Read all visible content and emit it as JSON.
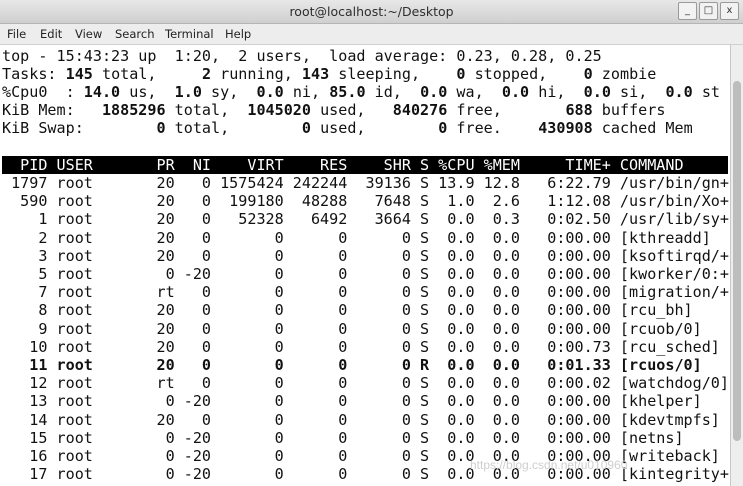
{
  "window": {
    "title": "root@localhost:~/Desktop",
    "buttons": [
      "_",
      "□",
      "x"
    ]
  },
  "menu": [
    "File",
    "Edit",
    "View",
    "Search",
    "Terminal",
    "Help"
  ],
  "summary": {
    "top_line": "top - 15:43:23 up  1:20,  2 users,  load average: 0.23, 0.28, 0.25",
    "tasks": [
      {
        "t": "Tasks: ",
        "b": false
      },
      {
        "t": "145",
        "b": true
      },
      {
        "t": " total,   ",
        "b": false
      },
      {
        "t": "  2",
        "b": true
      },
      {
        "t": " running, ",
        "b": false
      },
      {
        "t": "143",
        "b": true
      },
      {
        "t": " sleeping,  ",
        "b": false
      },
      {
        "t": "  0",
        "b": true
      },
      {
        "t": " stopped,  ",
        "b": false
      },
      {
        "t": "  0",
        "b": true
      },
      {
        "t": " zombie",
        "b": false
      }
    ],
    "cpu": [
      {
        "t": "%Cpu0  : ",
        "b": false
      },
      {
        "t": "14.0",
        "b": true
      },
      {
        "t": " us, ",
        "b": false
      },
      {
        "t": " 1.0",
        "b": true
      },
      {
        "t": " sy, ",
        "b": false
      },
      {
        "t": " 0.0",
        "b": true
      },
      {
        "t": " ni, ",
        "b": false
      },
      {
        "t": "85.0",
        "b": true
      },
      {
        "t": " id, ",
        "b": false
      },
      {
        "t": " 0.0",
        "b": true
      },
      {
        "t": " wa, ",
        "b": false
      },
      {
        "t": " 0.0",
        "b": true
      },
      {
        "t": " hi, ",
        "b": false
      },
      {
        "t": " 0.0",
        "b": true
      },
      {
        "t": " si, ",
        "b": false
      },
      {
        "t": " 0.0",
        "b": true
      },
      {
        "t": " st",
        "b": false
      }
    ],
    "mem": [
      {
        "t": "KiB Mem:  ",
        "b": false
      },
      {
        "t": " 1885296",
        "b": true
      },
      {
        "t": " total, ",
        "b": false
      },
      {
        "t": " 1045020",
        "b": true
      },
      {
        "t": " used, ",
        "b": false
      },
      {
        "t": "  840276",
        "b": true
      },
      {
        "t": " free,  ",
        "b": false
      },
      {
        "t": "     688",
        "b": true
      },
      {
        "t": " buffers",
        "b": false
      }
    ],
    "swap": [
      {
        "t": "KiB Swap: ",
        "b": false
      },
      {
        "t": "       0",
        "b": true
      },
      {
        "t": " total, ",
        "b": false
      },
      {
        "t": "       0",
        "b": true
      },
      {
        "t": " used, ",
        "b": false
      },
      {
        "t": "       0",
        "b": true
      },
      {
        "t": " free.  ",
        "b": false
      },
      {
        "t": "  430908",
        "b": true
      },
      {
        "t": " cached Mem",
        "b": false
      }
    ]
  },
  "columns": [
    "PID",
    "USER",
    "PR",
    "NI",
    "VIRT",
    "RES",
    "SHR",
    "S",
    "%CPU",
    "%MEM",
    "TIME+",
    "COMMAND"
  ],
  "processes": [
    {
      "pid": "1797",
      "user": "root",
      "pr": "20",
      "ni": "0",
      "virt": "1575424",
      "res": "242244",
      "shr": "39136",
      "s": "S",
      "cpu": "13.9",
      "mem": "12.8",
      "time": "6:22.79",
      "cmd": "/usr/bin/gn+",
      "bold": false
    },
    {
      "pid": "590",
      "user": "root",
      "pr": "20",
      "ni": "0",
      "virt": "199180",
      "res": "48288",
      "shr": "7648",
      "s": "S",
      "cpu": "1.0",
      "mem": "2.6",
      "time": "1:12.08",
      "cmd": "/usr/bin/Xo+",
      "bold": false
    },
    {
      "pid": "1",
      "user": "root",
      "pr": "20",
      "ni": "0",
      "virt": "52328",
      "res": "6492",
      "shr": "3664",
      "s": "S",
      "cpu": "0.0",
      "mem": "0.3",
      "time": "0:02.50",
      "cmd": "/usr/lib/sy+",
      "bold": false
    },
    {
      "pid": "2",
      "user": "root",
      "pr": "20",
      "ni": "0",
      "virt": "0",
      "res": "0",
      "shr": "0",
      "s": "S",
      "cpu": "0.0",
      "mem": "0.0",
      "time": "0:00.00",
      "cmd": "[kthreadd]",
      "bold": false
    },
    {
      "pid": "3",
      "user": "root",
      "pr": "20",
      "ni": "0",
      "virt": "0",
      "res": "0",
      "shr": "0",
      "s": "S",
      "cpu": "0.0",
      "mem": "0.0",
      "time": "0:00.00",
      "cmd": "[ksoftirqd/+",
      "bold": false
    },
    {
      "pid": "5",
      "user": "root",
      "pr": "0",
      "ni": "-20",
      "virt": "0",
      "res": "0",
      "shr": "0",
      "s": "S",
      "cpu": "0.0",
      "mem": "0.0",
      "time": "0:00.00",
      "cmd": "[kworker/0:+",
      "bold": false
    },
    {
      "pid": "7",
      "user": "root",
      "pr": "rt",
      "ni": "0",
      "virt": "0",
      "res": "0",
      "shr": "0",
      "s": "S",
      "cpu": "0.0",
      "mem": "0.0",
      "time": "0:00.00",
      "cmd": "[migration/+",
      "bold": false
    },
    {
      "pid": "8",
      "user": "root",
      "pr": "20",
      "ni": "0",
      "virt": "0",
      "res": "0",
      "shr": "0",
      "s": "S",
      "cpu": "0.0",
      "mem": "0.0",
      "time": "0:00.00",
      "cmd": "[rcu_bh]",
      "bold": false
    },
    {
      "pid": "9",
      "user": "root",
      "pr": "20",
      "ni": "0",
      "virt": "0",
      "res": "0",
      "shr": "0",
      "s": "S",
      "cpu": "0.0",
      "mem": "0.0",
      "time": "0:00.00",
      "cmd": "[rcuob/0]",
      "bold": false
    },
    {
      "pid": "10",
      "user": "root",
      "pr": "20",
      "ni": "0",
      "virt": "0",
      "res": "0",
      "shr": "0",
      "s": "S",
      "cpu": "0.0",
      "mem": "0.0",
      "time": "0:00.73",
      "cmd": "[rcu_sched]",
      "bold": false
    },
    {
      "pid": "11",
      "user": "root",
      "pr": "20",
      "ni": "0",
      "virt": "0",
      "res": "0",
      "shr": "0",
      "s": "R",
      "cpu": "0.0",
      "mem": "0.0",
      "time": "0:01.33",
      "cmd": "[rcuos/0]",
      "bold": true
    },
    {
      "pid": "12",
      "user": "root",
      "pr": "rt",
      "ni": "0",
      "virt": "0",
      "res": "0",
      "shr": "0",
      "s": "S",
      "cpu": "0.0",
      "mem": "0.0",
      "time": "0:00.02",
      "cmd": "[watchdog/0]",
      "bold": false
    },
    {
      "pid": "13",
      "user": "root",
      "pr": "0",
      "ni": "-20",
      "virt": "0",
      "res": "0",
      "shr": "0",
      "s": "S",
      "cpu": "0.0",
      "mem": "0.0",
      "time": "0:00.00",
      "cmd": "[khelper]",
      "bold": false
    },
    {
      "pid": "14",
      "user": "root",
      "pr": "20",
      "ni": "0",
      "virt": "0",
      "res": "0",
      "shr": "0",
      "s": "S",
      "cpu": "0.0",
      "mem": "0.0",
      "time": "0:00.00",
      "cmd": "[kdevtmpfs]",
      "bold": false
    },
    {
      "pid": "15",
      "user": "root",
      "pr": "0",
      "ni": "-20",
      "virt": "0",
      "res": "0",
      "shr": "0",
      "s": "S",
      "cpu": "0.0",
      "mem": "0.0",
      "time": "0:00.00",
      "cmd": "[netns]",
      "bold": false
    },
    {
      "pid": "16",
      "user": "root",
      "pr": "0",
      "ni": "-20",
      "virt": "0",
      "res": "0",
      "shr": "0",
      "s": "S",
      "cpu": "0.0",
      "mem": "0.0",
      "time": "0:00.00",
      "cmd": "[writeback]",
      "bold": false
    },
    {
      "pid": "17",
      "user": "root",
      "pr": "0",
      "ni": "-20",
      "virt": "0",
      "res": "0",
      "shr": "0",
      "s": "S",
      "cpu": "0.0",
      "mem": "0.0",
      "time": "0:00.00",
      "cmd": "[kintegrity+",
      "bold": false
    }
  ],
  "watermark": "https://blog.csdn.net/u010960"
}
